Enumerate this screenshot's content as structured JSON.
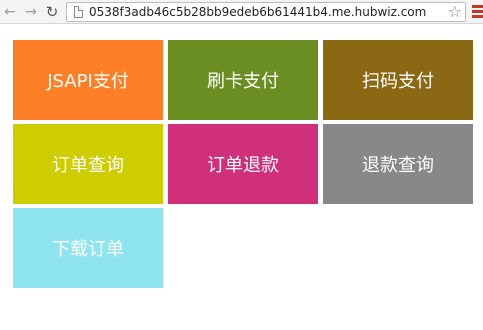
{
  "browser": {
    "url": "0538f3adb46c5b28bb9edeb6b61441b4.me.hubwiz.com",
    "back_icon": "arrow-left-icon",
    "forward_icon": "arrow-right-icon",
    "reload_icon": "reload-icon",
    "bookmark_icon": "star-icon",
    "menu_icon": "hamburger-menu-icon"
  },
  "tiles": [
    {
      "label": "JSAPI支付",
      "color": "#ff7f27"
    },
    {
      "label": "刷卡支付",
      "color": "#6b8e23"
    },
    {
      "label": "扫码支付",
      "color": "#8b6914"
    },
    {
      "label": "订单查询",
      "color": "#cdcd00"
    },
    {
      "label": "订单退款",
      "color": "#d0307a"
    },
    {
      "label": "退款查询",
      "color": "#888888"
    },
    {
      "label": "下载订单",
      "color": "#8fe5ef"
    }
  ]
}
